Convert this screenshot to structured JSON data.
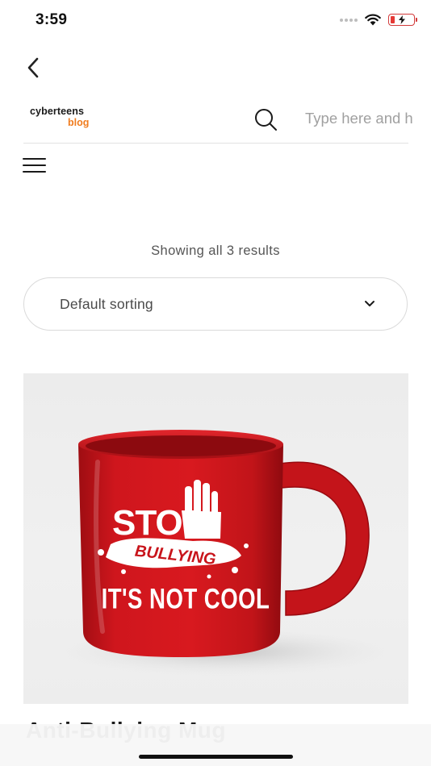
{
  "status_bar": {
    "time": "3:59",
    "icons": [
      "signal-dots-icon",
      "wifi-icon",
      "battery-low-charging-icon"
    ],
    "battery_color": "#e53935"
  },
  "nav": {
    "back_icon": "chevron-left-icon"
  },
  "header": {
    "logo_top": "cyberteens",
    "logo_bottom": "blog",
    "logo_accent_color": "#f07c1e",
    "search_icon": "search-icon",
    "search_placeholder": "Type here and h"
  },
  "menu": {
    "icon": "hamburger-menu-icon"
  },
  "shop": {
    "result_count": "Showing all 3 results",
    "sort": {
      "selected": "Default sorting",
      "icon": "chevron-down-icon"
    }
  },
  "product": {
    "image_text_line1": "STOP",
    "image_text_line2": "BULLYING",
    "image_text_line3": "IT'S NOT COOL",
    "mug_color": "#c8141b",
    "title": "Anti-Bullying Mug"
  }
}
